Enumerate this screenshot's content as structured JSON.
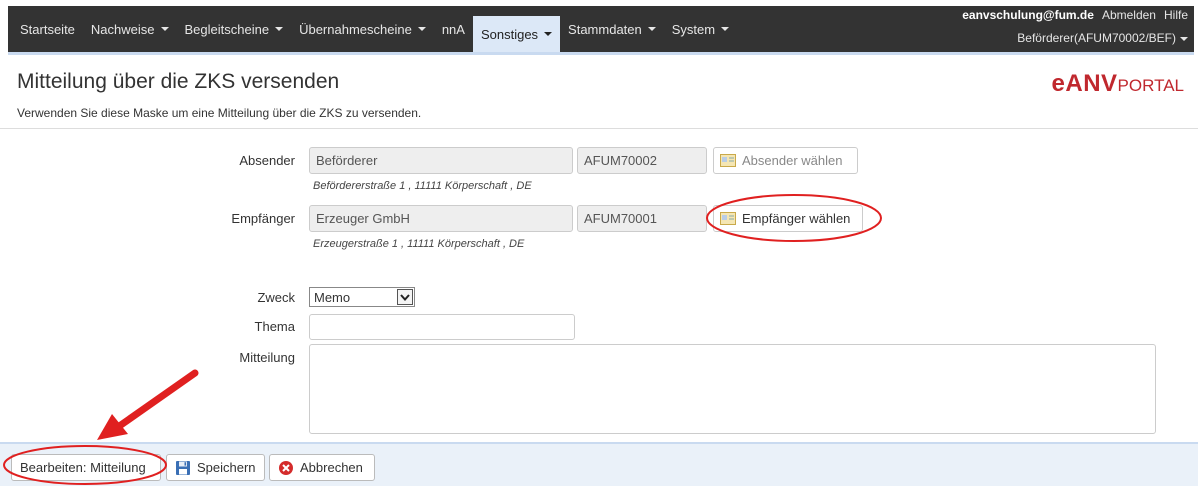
{
  "navbar": {
    "items": [
      {
        "label": "Startseite",
        "dropdown": false,
        "active": false
      },
      {
        "label": "Nachweise",
        "dropdown": true,
        "active": false
      },
      {
        "label": "Begleitscheine",
        "dropdown": true,
        "active": false
      },
      {
        "label": "Übernahmescheine",
        "dropdown": true,
        "active": false
      },
      {
        "label": "nnA",
        "dropdown": false,
        "active": false
      },
      {
        "label": "Sonstiges",
        "dropdown": true,
        "active": true
      },
      {
        "label": "Stammdaten",
        "dropdown": true,
        "active": false
      },
      {
        "label": "System",
        "dropdown": true,
        "active": false
      }
    ],
    "user": "eanvschulung@fum.de",
    "logout": "Abmelden",
    "help": "Hilfe",
    "role": "Beförderer(AFUM70002/BEF)"
  },
  "page": {
    "title": "Mitteilung über die ZKS versenden",
    "description": "Verwenden Sie diese Maske um eine Mitteilung über die ZKS zu versenden.",
    "logo_main": "eANV",
    "logo_small": "PORTAL"
  },
  "form": {
    "absender": {
      "label": "Absender",
      "name": "Beförderer",
      "number": "AFUM70002",
      "button": "Absender wählen",
      "address": "Befördererstraße 1 , 11111 Körperschaft , DE"
    },
    "empfaenger": {
      "label": "Empfänger",
      "name": "Erzeuger GmbH",
      "number": "AFUM70001",
      "button": "Empfänger wählen",
      "address": "Erzeugerstraße 1 , 11111 Körperschaft , DE"
    },
    "zweck": {
      "label": "Zweck",
      "value": "Memo"
    },
    "thema": {
      "label": "Thema",
      "value": ""
    },
    "mitteilung": {
      "label": "Mitteilung",
      "value": ""
    }
  },
  "bottom": {
    "edit": "Bearbeiten: Mitteilung",
    "save": "Speichern",
    "cancel": "Abbrechen"
  },
  "colors": {
    "navbar": "#333333",
    "active_tab": "#dce8f7",
    "logo": "#c0282e",
    "annotation": "#e02020"
  }
}
